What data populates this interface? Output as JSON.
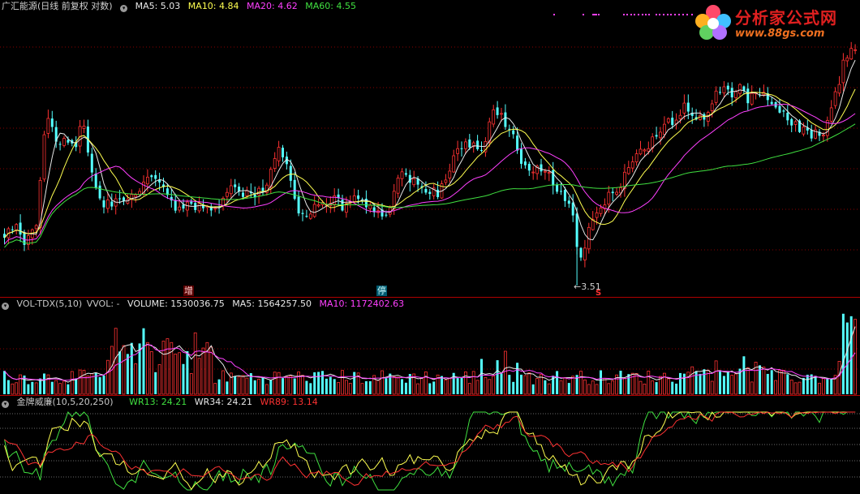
{
  "main_header": {
    "title": "广汇能源(日线 前复权 对数)",
    "ma5": "MA5: 5.03",
    "ma10": "MA10: 4.84",
    "ma20": "MA20: 4.62",
    "ma60": "MA60: 4.55"
  },
  "vol_header": {
    "name": "VOL-TDX(5,10)",
    "vvol": "VVOL: -",
    "volume": "VOLUME: 1530036.75",
    "ma5": "MA5: 1564257.50",
    "ma10": "MA10: 1172402.63"
  },
  "wr_header": {
    "name": "金牌威廉(10,5,20,250)",
    "wr13": "WR13: 24.21",
    "wr34": "WR34: 24.21",
    "wr89": "WR89: 13.14"
  },
  "logo": {
    "text": "分析家公式网",
    "url": "www.88gs.com"
  },
  "marks": {
    "zeng": "增",
    "ting": "停",
    "low": "3.51",
    "low_flag": "S"
  },
  "colors": {
    "up": "#ff3232",
    "down": "#54ffff",
    "ma5": "#e8e8e8",
    "ma10": "#ffff50",
    "ma20": "#ff40ff",
    "ma60": "#40e040",
    "grid": "#8a0000",
    "axis": "#b00000"
  },
  "chart_data": [
    {
      "type": "candlestick",
      "name": "main",
      "count": 215,
      "price_range": [
        3.51,
        6.06
      ],
      "low_value": 3.51,
      "series": [
        "MA5",
        "MA10",
        "MA20",
        "MA60"
      ]
    },
    {
      "type": "bar",
      "name": "volume",
      "series": [
        "VOLUME",
        "MA5",
        "MA10"
      ]
    },
    {
      "type": "line",
      "name": "williams",
      "ylim": [
        0,
        100
      ],
      "series": [
        "WR13",
        "WR34",
        "WR89"
      ]
    }
  ]
}
